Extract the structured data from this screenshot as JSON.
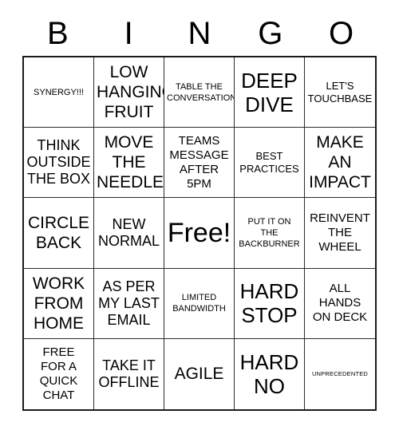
{
  "header": {
    "letters": [
      "B",
      "I",
      "N",
      "G",
      "O"
    ]
  },
  "grid": {
    "columns": 5,
    "rows": 5,
    "border_color": "#1a1a1a",
    "line_color": "#2b2b2b",
    "background": "#ffffff",
    "text_color": "#000000"
  },
  "cells": [
    {
      "text": "SYNERGY!!!",
      "size": "sz-xs"
    },
    {
      "text": "LOW\nHANGING\nFRUIT",
      "size": "sz-xl"
    },
    {
      "text": "TABLE THE\nCONVERSATION",
      "size": "sz-xs"
    },
    {
      "text": "DEEP\nDIVE",
      "size": "sz-xxl"
    },
    {
      "text": "LET'S\nTOUCHBASE",
      "size": "sz-s"
    },
    {
      "text": "THINK\nOUTSIDE\nTHE BOX",
      "size": "sz-l"
    },
    {
      "text": "MOVE\nTHE\nNEEDLE",
      "size": "sz-xl"
    },
    {
      "text": "TEAMS\nMESSAGE\nAFTER\n5PM",
      "size": "sz-m"
    },
    {
      "text": "BEST\nPRACTICES",
      "size": "sz-s"
    },
    {
      "text": "MAKE\nAN\nIMPACT",
      "size": "sz-xl"
    },
    {
      "text": "CIRCLE\nBACK",
      "size": "sz-xl"
    },
    {
      "text": "NEW\nNORMAL",
      "size": "sz-l"
    },
    {
      "text": "Free!",
      "size": "sz-free"
    },
    {
      "text": "PUT IT ON\nTHE\nBACKBURNER",
      "size": "sz-xs"
    },
    {
      "text": "REINVENT\nTHE\nWHEEL",
      "size": "sz-m"
    },
    {
      "text": "WORK\nFROM\nHOME",
      "size": "sz-xl"
    },
    {
      "text": "AS PER\nMY LAST\nEMAIL",
      "size": "sz-l"
    },
    {
      "text": "LIMITED\nBANDWIDTH",
      "size": "sz-xs"
    },
    {
      "text": "HARD\nSTOP",
      "size": "sz-xxl"
    },
    {
      "text": "ALL\nHANDS\nON DECK",
      "size": "sz-m"
    },
    {
      "text": "FREE\nFOR A\nQUICK\nCHAT",
      "size": "sz-m"
    },
    {
      "text": "TAKE IT\nOFFLINE",
      "size": "sz-l"
    },
    {
      "text": "AGILE",
      "size": "sz-xl"
    },
    {
      "text": "HARD\nNO",
      "size": "sz-xxl"
    },
    {
      "text": "UNPRECEDENTED",
      "size": "sz-xxs"
    }
  ]
}
